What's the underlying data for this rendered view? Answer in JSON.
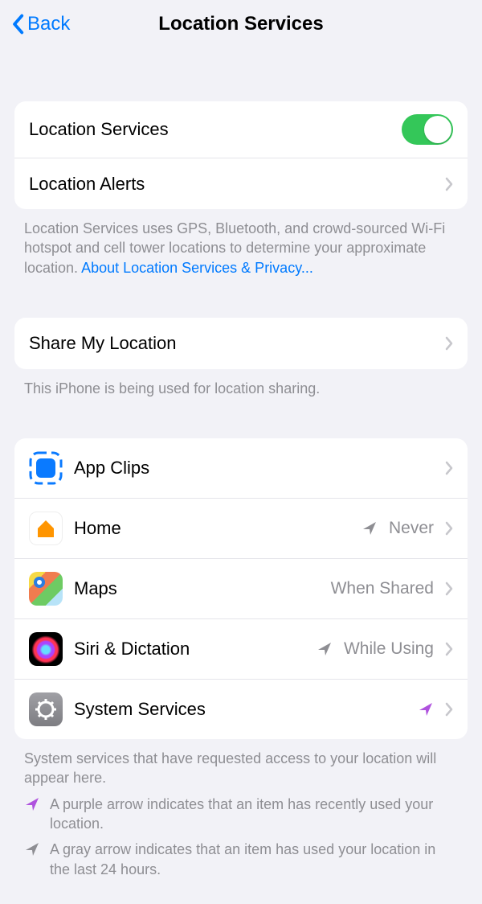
{
  "nav": {
    "back": "Back",
    "title": "Location Services"
  },
  "group1": {
    "location_services": "Location Services",
    "location_alerts": "Location Alerts",
    "footer_text": "Location Services uses GPS, Bluetooth, and crowd-sourced Wi-Fi hotspot and cell tower locations to determine your approximate location. ",
    "footer_link": "About Location Services & Privacy..."
  },
  "group2": {
    "share": "Share My Location",
    "footer": "This iPhone is being used for location sharing."
  },
  "apps": {
    "title_appclips": "App Clips",
    "title_home": "Home",
    "title_maps": "Maps",
    "title_siri": "Siri & Dictation",
    "title_sys": "System Services",
    "val_home": "Never",
    "val_maps": "When Shared",
    "val_siri": "While Using"
  },
  "legend": {
    "intro": "System services that have requested access to your location will appear here.",
    "purple": "A purple arrow indicates that an item has recently used your location.",
    "gray": "A gray arrow indicates that an item has used your location in the last 24 hours."
  },
  "toggle_state": {
    "location_services_on": true
  }
}
